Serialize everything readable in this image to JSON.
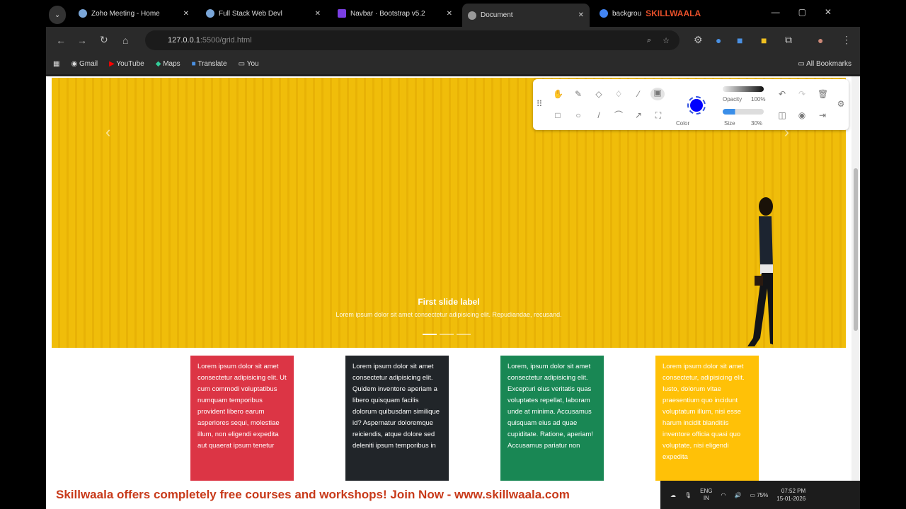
{
  "browser": {
    "tabs": [
      {
        "label": "Zoho Meeting - Home"
      },
      {
        "label": "Full Stack Web Devl"
      },
      {
        "label": "Navbar · Bootstrap v5.2"
      },
      {
        "label": "Document",
        "active": true
      },
      {
        "label": "backgrou"
      }
    ],
    "url_host": "127.0.0.1",
    "url_rest": ":5500/grid.html",
    "bookmarks": [
      "Gmail",
      "YouTube",
      "Maps",
      "Translate",
      "You"
    ],
    "all_bookmarks": "All Bookmarks",
    "watermark": "SKILLWAALA"
  },
  "hero": {
    "title": "First slide label",
    "text": "Lorem ipsum dolor sit amet consectetur adipisicing elit. Repudiandae, recusand.",
    "slides": 3,
    "active_slide": 1
  },
  "cards": [
    {
      "color": "#dc3545",
      "text": "Lorem ipsum dolor sit amet consectetur adipisicing elit. Ut cum commodi voluptatibus numquam temporibus provident libero earum asperiores sequi, molestiae illum, non eligendi expedita aut quaerat ipsum tenetur"
    },
    {
      "color": "#212529",
      "text": "Lorem ipsum dolor sit amet consectetur adipisicing elit. Quidem inventore aperiam a libero quisquam facilis dolorum quibusdam similique id? Aspernatur doloremque reiciendis, atque dolore sed deleniti ipsum temporibus in"
    },
    {
      "color": "#198754",
      "text": "Lorem, ipsum dolor sit amet consectetur adipisicing elit. Excepturi eius veritatis quas voluptates repellat, laboram unde at minima. Accusamus quisquam eius ad quae cupiditate. Ratione, aperiam! Accusamus pariatur non"
    },
    {
      "color": "#ffc107",
      "text": "Lorem ipsum dolor sit amet consectetur, adipisicing elit. Iusto, dolorum vitae praesentium quo incidunt voluptatum illum, nisi esse harum incidit blanditiis inventore officia quasi quo voluptate, nisi eligendi expedita"
    }
  ],
  "draw_toolbar": {
    "opacity_label": "Opacity",
    "opacity_value": "100%",
    "size_label": "Size",
    "size_value": "30%",
    "color_label": "Color",
    "pen_color": "#0000ff"
  },
  "banner": "Skillwaala offers completely free courses and workshops! Join Now - www.skillwaala.com",
  "taskbar": {
    "lang": "ENG",
    "region": "IN",
    "battery": "75%",
    "time": "07:52 PM",
    "date": "15-01-2026"
  }
}
